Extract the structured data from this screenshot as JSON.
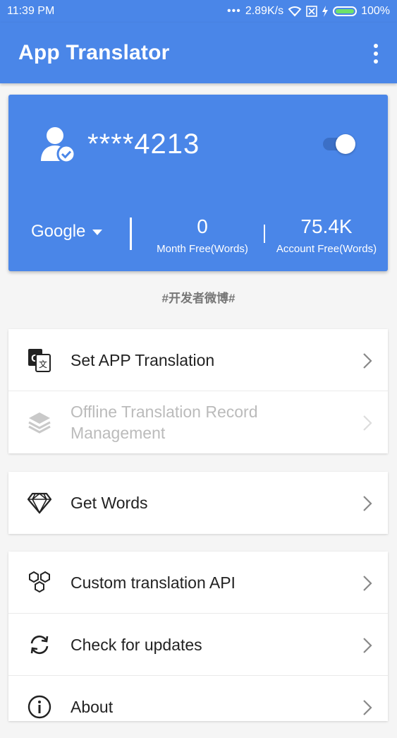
{
  "status_bar": {
    "time": "11:39 PM",
    "network_speed": "2.89K/s",
    "battery": "100%"
  },
  "app_bar": {
    "title": "App Translator",
    "menu_icon": "more-vert-icon"
  },
  "account": {
    "user_id": "****4213",
    "toggle_on": true,
    "engine": "Google",
    "month_free_value": "0",
    "month_free_label": "Month Free(Words)",
    "account_free_value": "75.4K",
    "account_free_label": "Account Free(Words)"
  },
  "dev_weibo": "#开发者微博#",
  "menu_groups": [
    {
      "items": [
        {
          "label": "Set APP Translation",
          "icon": "translate-icon",
          "enabled": true
        },
        {
          "label": "Offline Translation Record Management",
          "icon": "layers-icon",
          "enabled": false
        }
      ]
    },
    {
      "items": [
        {
          "label": "Get Words",
          "icon": "diamond-icon",
          "enabled": true
        }
      ]
    },
    {
      "items": [
        {
          "label": "Custom translation API",
          "icon": "hexagons-icon",
          "enabled": true
        },
        {
          "label": "Check for updates",
          "icon": "sync-icon",
          "enabled": true
        },
        {
          "label": "About",
          "icon": "info-icon",
          "enabled": true
        }
      ]
    }
  ],
  "colors": {
    "primary": "#4a86e8",
    "background": "#f5f5f5"
  }
}
